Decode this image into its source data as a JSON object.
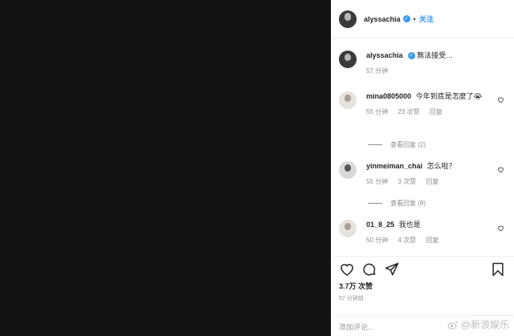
{
  "post": {
    "author": "alyssachia",
    "follow_label": "关注",
    "dot": "•",
    "caption": "無法接受…",
    "caption_time": "57 分钟",
    "likes": "3.7万 次赞",
    "posted_time": "57 分钟前",
    "add_comment_placeholder": "添加评论..."
  },
  "comments": [
    {
      "user": "mina0805000",
      "text": "今年到底是怎麼了😭",
      "time": "55 分钟",
      "likes": "23 次赞",
      "reply": "回复",
      "view_replies": "查看回复 (2)"
    },
    {
      "user": "yinmeiman_chai",
      "text": "怎么啦？",
      "time": "55 分钟",
      "likes": "3 次赞",
      "reply": "回复",
      "view_replies": "查看回复 (8)"
    },
    {
      "user": "01_8_25",
      "text": "我也是",
      "time": "50 分钟",
      "likes": "4 次赞",
      "reply": "回复"
    }
  ],
  "watermark": {
    "text": "@新浪娱乐"
  },
  "icons": [
    "heart-icon",
    "comment-icon",
    "share-icon",
    "bookmark-icon",
    "verified-icon"
  ],
  "colors": {
    "accent": "#3897f0",
    "muted": "#8e8e8e",
    "media_bg": "#111111"
  }
}
